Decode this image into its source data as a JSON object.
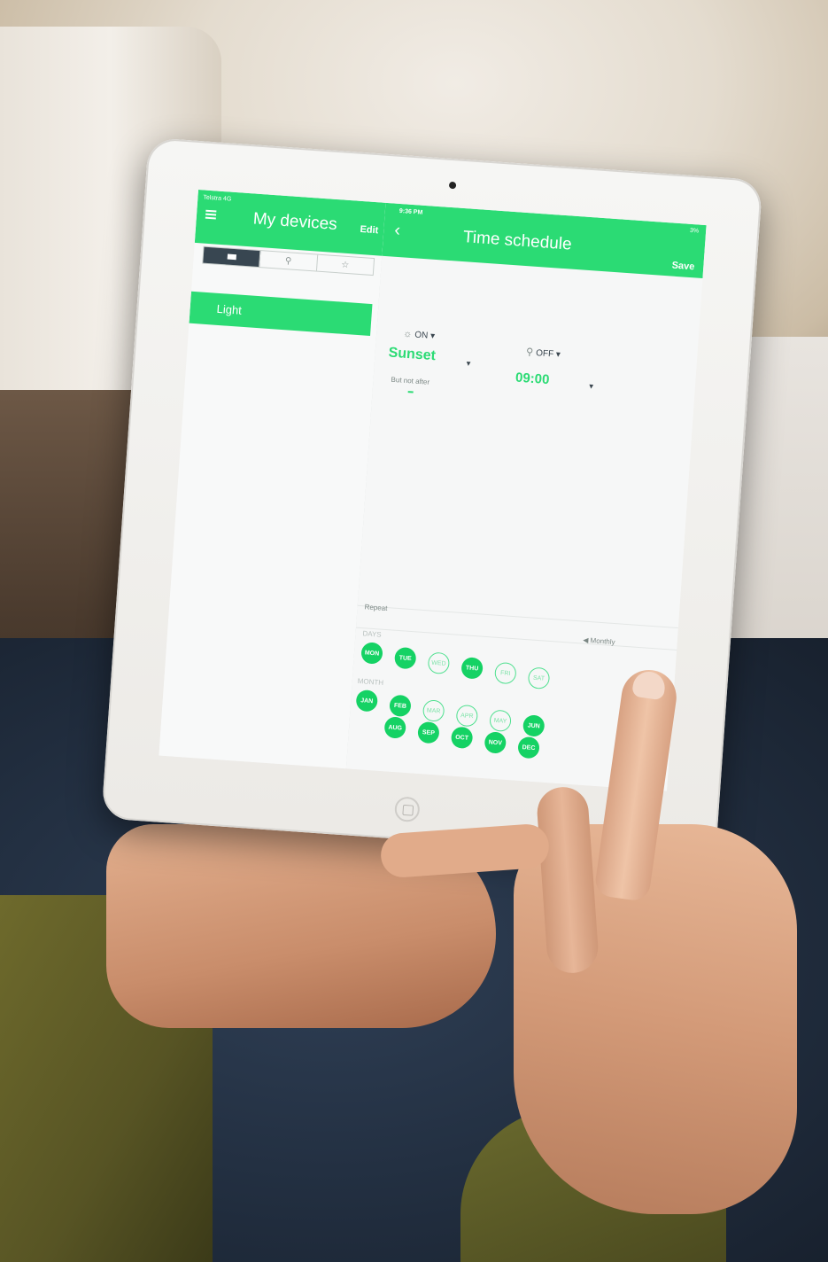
{
  "status_bar": {
    "carrier": "Telstra 4G",
    "time": "9:36 PM",
    "battery": "3%"
  },
  "left_panel": {
    "title": "My devices",
    "edit_label": "Edit",
    "tabs": [
      {
        "icon": "list-icon",
        "active": true
      },
      {
        "icon": "bulb-icon",
        "active": false
      },
      {
        "icon": "star-icon",
        "active": false
      }
    ],
    "devices": [
      {
        "label": "Light",
        "selected": true
      }
    ]
  },
  "right_panel": {
    "title": "Time schedule",
    "save_label": "Save",
    "on": {
      "label": "ON",
      "value": "Sunset",
      "icon": "bulb-on-icon"
    },
    "off": {
      "label": "OFF",
      "value": "09:00",
      "icon": "bulb-off-icon"
    },
    "not_after_label": "But not after",
    "repeat_label": "Repeat",
    "frequency": "Monthly",
    "days_label": "DAYS",
    "months_label": "MONTH",
    "days": [
      {
        "label": "MON",
        "selected": true
      },
      {
        "label": "TUE",
        "selected": true
      },
      {
        "label": "WED",
        "selected": false
      },
      {
        "label": "THU",
        "selected": true
      },
      {
        "label": "FRI",
        "selected": false
      },
      {
        "label": "SAT",
        "selected": false
      }
    ],
    "months": [
      {
        "label": "JAN",
        "selected": true
      },
      {
        "label": "FEB",
        "selected": true
      },
      {
        "label": "MAR",
        "selected": false
      },
      {
        "label": "APR",
        "selected": false
      },
      {
        "label": "MAY",
        "selected": false
      },
      {
        "label": "JUN",
        "selected": true
      },
      {
        "label": "AUG",
        "selected": true
      },
      {
        "label": "SEP",
        "selected": true
      },
      {
        "label": "OCT",
        "selected": true
      },
      {
        "label": "NOV",
        "selected": true
      },
      {
        "label": "DEC",
        "selected": true
      }
    ]
  },
  "colors": {
    "accent": "#2bdb74",
    "selected_circle": "#15d264",
    "segment_active": "#384651"
  }
}
